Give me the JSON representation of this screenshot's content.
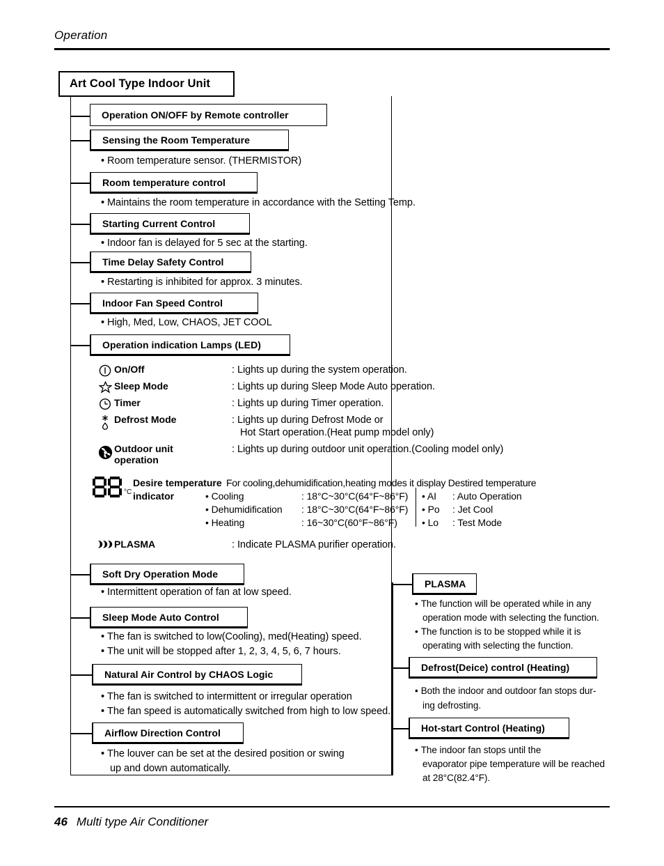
{
  "header": {
    "section": "Operation"
  },
  "footer": {
    "page_number": "46",
    "doc_title": "Multi type Air Conditioner"
  },
  "diagram": {
    "root_title": "Art Cool Type Indoor Unit",
    "nodes": [
      {
        "label": "Operation ON/OFF by Remote controller",
        "bullets": []
      },
      {
        "label": "Sensing the Room Temperature",
        "bullets": [
          "Room temperature sensor. (THERMISTOR)"
        ]
      },
      {
        "label": "Room temperature control",
        "bullets": [
          "Maintains the room temperature in accordance with the Setting Temp."
        ]
      },
      {
        "label": "Starting Current Control",
        "bullets": [
          "Indoor fan is delayed for 5 sec at the starting."
        ]
      },
      {
        "label": "Time Delay Safety Control",
        "bullets": [
          "Restarting is inhibited for approx. 3 minutes."
        ]
      },
      {
        "label": "Indoor Fan Speed Control",
        "bullets": [
          "High, Med, Low, CHAOS, JET COOL"
        ]
      },
      {
        "label": "Operation indication Lamps (LED)",
        "bullets": []
      },
      {
        "label": "Soft Dry Operation Mode",
        "bullets": [
          "Intermittent operation of fan at low speed."
        ]
      },
      {
        "label": "Sleep Mode Auto Control",
        "bullets": [
          "The fan is switched to low(Cooling), med(Heating) speed.",
          "The unit will be stopped after 1, 2, 3, 4, 5, 6, 7 hours."
        ]
      },
      {
        "label": "Natural Air Control by CHAOS Logic",
        "bullets": [
          "The fan is switched to intermittent or irregular operation",
          "The fan speed is automatically switched from high to low speed."
        ]
      },
      {
        "label": "Airflow Direction Control",
        "bullets": [
          "The louver can be set at the desired position or swing",
          "up and down automatically."
        ]
      }
    ],
    "right_nodes": [
      {
        "label": "PLASMA",
        "bullets": [
          "The function will be operated while in any",
          "operation mode with selecting the function.",
          "The function is to be stopped while it is",
          "operating with selecting the function."
        ]
      },
      {
        "label": "Defrost(Deice) control (Heating)",
        "bullets": [
          "Both the indoor and outdoor fan  stops dur-",
          "ing defrosting."
        ]
      },
      {
        "label": "Hot-start Control (Heating)",
        "bullets": [
          "The indoor fan stops until the",
          "evaporator pipe temperature will be reached",
          "at 28°C(82.4°F)."
        ]
      }
    ],
    "led_items": [
      {
        "icon": "power-icon",
        "name": "On/Off",
        "desc": ": Lights up during the system operation."
      },
      {
        "icon": "star-icon",
        "name": "Sleep Mode",
        "desc": ": Lights up during Sleep Mode Auto operation."
      },
      {
        "icon": "clock-icon",
        "name": "Timer",
        "desc": ": Lights up during Timer operation."
      },
      {
        "icon": "snowflake-drop-icon",
        "name": "Defrost Mode",
        "desc": ": Lights up during Defrost Mode or",
        "desc2": "Hot Start operation.(Heat pump model only)"
      },
      {
        "icon": "fan-icon",
        "name": "Outdoor unit",
        "name2": "operation",
        "desc": ": Lights up during outdoor unit operation.(Cooling model only)"
      }
    ],
    "desire_temp": {
      "display_value": "88",
      "display_unit": "°C",
      "label_line1": "Desire temperature",
      "label_line2": "indicator",
      "lead": "For cooling,dehumidification,heating modes it display Destired temperature",
      "modes": [
        {
          "name": "Cooling",
          "range": ": 18°C~30°C(64°F~86°F)"
        },
        {
          "name": "Dehumidification",
          "range": ": 18°C~30°C(64°F~86°F)"
        },
        {
          "name": "Heating",
          "range": ": 16~30°C(60°F~86°F)"
        }
      ],
      "codes": [
        {
          "code": "AI",
          "meaning": ": Auto Operation"
        },
        {
          "code": "Po",
          "meaning": ": Jet Cool"
        },
        {
          "code": "Lo",
          "meaning": ": Test Mode"
        }
      ]
    },
    "plasma_row": {
      "icon": "plasma-waves-icon",
      "name": "PLASMA",
      "desc": ": Indicate PLASMA purifier operation."
    }
  }
}
